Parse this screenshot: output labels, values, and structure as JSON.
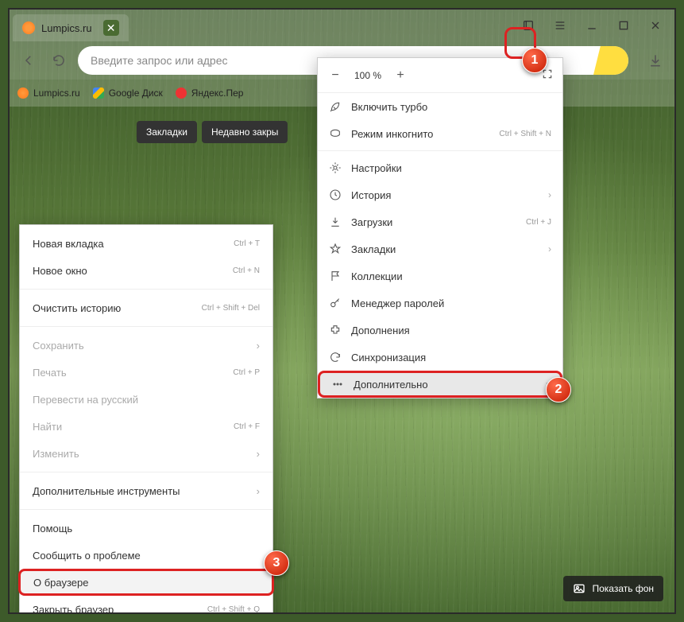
{
  "tab": {
    "title": "Lumpics.ru"
  },
  "search": {
    "placeholder": "Введите запрос или адрес"
  },
  "bookmarks": [
    {
      "label": "Lumpics.ru"
    },
    {
      "label": "Google Диск"
    },
    {
      "label": "Яндекс.Пер"
    }
  ],
  "quick": [
    {
      "label": "Закладки"
    },
    {
      "label": "Недавно закры"
    }
  ],
  "zoom": {
    "value": "100 %"
  },
  "mainmenu": {
    "turbo": "Включить турбо",
    "incognito": "Режим инкогнито",
    "incognito_hint": "Ctrl + Shift + N",
    "settings": "Настройки",
    "history": "История",
    "downloads": "Загрузки",
    "downloads_hint": "Ctrl + J",
    "bookmarks": "Закладки",
    "collections": "Коллекции",
    "passwords": "Менеджер паролей",
    "addons": "Дополнения",
    "sync": "Синхронизация",
    "more": "Дополнительно"
  },
  "submenu": {
    "newtab": "Новая вкладка",
    "newtab_hint": "Ctrl + T",
    "newwin": "Новое окно",
    "newwin_hint": "Ctrl + N",
    "clear": "Очистить историю",
    "clear_hint": "Ctrl + Shift + Del",
    "save": "Сохранить",
    "print": "Печать",
    "print_hint": "Ctrl + P",
    "translate": "Перевести на русский",
    "find": "Найти",
    "find_hint": "Ctrl + F",
    "edit": "Изменить",
    "tools": "Дополнительные инструменты",
    "help": "Помощь",
    "report": "Сообщить о проблеме",
    "about": "О браузере",
    "close": "Закрыть браузер",
    "close_hint": "Ctrl + Shift + Q"
  },
  "showbg": {
    "label": "Показать фон"
  },
  "badges": {
    "b1": "1",
    "b2": "2",
    "b3": "3"
  }
}
